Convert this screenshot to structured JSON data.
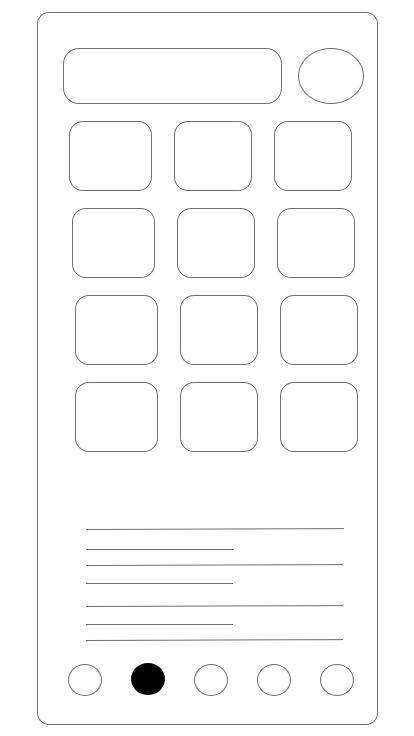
{
  "grid": {
    "tiles": [
      {
        "id": "tile-1"
      },
      {
        "id": "tile-2"
      },
      {
        "id": "tile-3"
      },
      {
        "id": "tile-4"
      },
      {
        "id": "tile-5"
      },
      {
        "id": "tile-6"
      },
      {
        "id": "tile-7"
      },
      {
        "id": "tile-8"
      },
      {
        "id": "tile-9"
      },
      {
        "id": "tile-10"
      },
      {
        "id": "tile-11"
      },
      {
        "id": "tile-12"
      }
    ]
  },
  "pager": {
    "page_count": 5,
    "active_page": 2
  },
  "colors": {
    "stroke": "#6f6f6f",
    "active_dot": "#000000",
    "background": "#ffffff"
  }
}
